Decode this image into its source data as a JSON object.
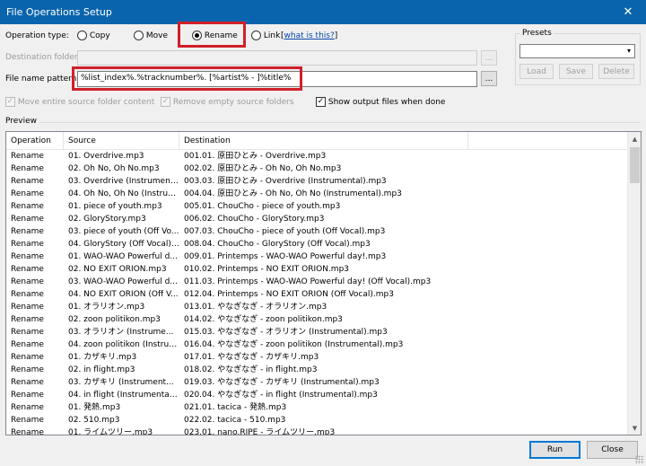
{
  "window": {
    "title": "File Operations Setup",
    "close_glyph": "✕"
  },
  "operation": {
    "label": "Operation type:",
    "options": [
      "Copy",
      "Move",
      "Rename",
      "Link"
    ],
    "selected": "Rename",
    "what_link": "what is this?"
  },
  "destination": {
    "label": "Destination folder:",
    "value": "",
    "browse": "..."
  },
  "pattern": {
    "label": "File name pattern:",
    "value": "%list_index%.%tracknumber%. [%artist% - ]%title%",
    "browse": "..."
  },
  "options": {
    "move_entire": "Move entire source folder content",
    "remove_empty": "Remove empty source folders",
    "show_output": "Show output files when done"
  },
  "presets": {
    "label": "Presets",
    "load": "Load",
    "save": "Save",
    "delete": "Delete"
  },
  "preview": {
    "label": "Preview",
    "columns": [
      "Operation",
      "Source",
      "Destination"
    ],
    "rows": [
      [
        "Rename",
        "01. Overdrive.mp3",
        "001.01. 原田ひとみ - Overdrive.mp3"
      ],
      [
        "Rename",
        "02. Oh No, Oh No.mp3",
        "002.02. 原田ひとみ - Oh No, Oh No.mp3"
      ],
      [
        "Rename",
        "03. Overdrive (Instrument...",
        "003.03. 原田ひとみ - Overdrive (Instrumental).mp3"
      ],
      [
        "Rename",
        "04. Oh No, Oh No (Instrum...",
        "004.04. 原田ひとみ - Oh No, Oh No (Instrumental).mp3"
      ],
      [
        "Rename",
        "01. piece of youth.mp3",
        "005.01. ChouCho - piece of youth.mp3"
      ],
      [
        "Rename",
        "02. GloryStory.mp3",
        "006.02. ChouCho - GloryStory.mp3"
      ],
      [
        "Rename",
        "03. piece of youth (Off Vo...",
        "007.03. ChouCho - piece of youth (Off Vocal).mp3"
      ],
      [
        "Rename",
        "04. GloryStory (Off Vocal)....",
        "008.04. ChouCho - GloryStory (Off Vocal).mp3"
      ],
      [
        "Rename",
        "01. WAO-WAO Powerful d...",
        "009.01. Printemps - WAO-WAO Powerful day!.mp3"
      ],
      [
        "Rename",
        "02. NO EXIT ORION.mp3",
        "010.02. Printemps - NO EXIT ORION.mp3"
      ],
      [
        "Rename",
        "03. WAO-WAO Powerful d...",
        "011.03. Printemps - WAO-WAO Powerful day! (Off Vocal).mp3"
      ],
      [
        "Rename",
        "04. NO EXIT ORION (Off V...",
        "012.04. Printemps - NO EXIT ORION (Off Vocal).mp3"
      ],
      [
        "Rename",
        "01. オラリオン.mp3",
        "013.01. やなぎなぎ - オラリオン.mp3"
      ],
      [
        "Rename",
        "02. zoon politikon.mp3",
        "014.02. やなぎなぎ - zoon politikon.mp3"
      ],
      [
        "Rename",
        "03. オラリオン (Instrume...",
        "015.03. やなぎなぎ - オラリオン (Instrumental).mp3"
      ],
      [
        "Rename",
        "04. zoon politikon (Instrum...",
        "016.04. やなぎなぎ - zoon politikon (Instrumental).mp3"
      ],
      [
        "Rename",
        "01. カザキリ.mp3",
        "017.01. やなぎなぎ - カザキリ.mp3"
      ],
      [
        "Rename",
        "02. in flight.mp3",
        "018.02. やなぎなぎ - in flight.mp3"
      ],
      [
        "Rename",
        "03. カザキリ (Instrument...",
        "019.03. やなぎなぎ - カザキリ (Instrumental).mp3"
      ],
      [
        "Rename",
        "04. in flight (Instrumental)....",
        "020.04. やなぎなぎ - in flight (Instrumental).mp3"
      ],
      [
        "Rename",
        "01. 発熱.mp3",
        "021.01. tacica - 発熱.mp3"
      ],
      [
        "Rename",
        "02. 510.mp3",
        "022.02. tacica - 510.mp3"
      ],
      [
        "Rename",
        "01. ライムツリー.mp3",
        "023.01. nano.RIPE - ライムツリー.mp3"
      ]
    ]
  },
  "buttons": {
    "run": "Run",
    "close": "Close"
  },
  "colors": {
    "titlebar": "#0a64ad",
    "highlight": "#d0202a",
    "link": "#0645ad"
  }
}
